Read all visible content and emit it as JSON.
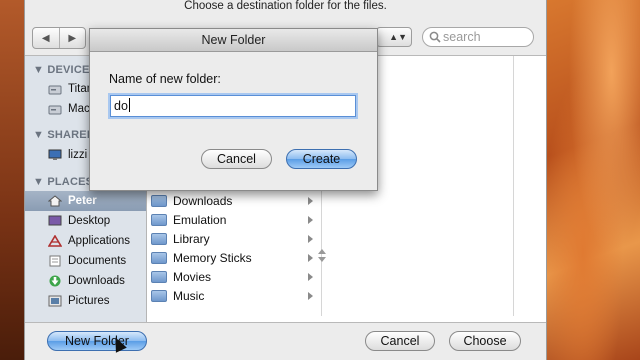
{
  "colors": {
    "accent_blue": "#5a9de6",
    "sidebar_bg": "#dde3ea",
    "selection": "#8a9cb3"
  },
  "sheet": {
    "title": "Choose a destination folder for the files.",
    "search_placeholder": "search"
  },
  "sidebar": {
    "devices_heading": "DEVICES",
    "devices": [
      {
        "label": "Titan",
        "icon": "hard-drive-icon"
      },
      {
        "label": "Maci",
        "icon": "hard-drive-icon"
      }
    ],
    "shared_heading": "SHARED",
    "shared": [
      {
        "label": "lizzi",
        "icon": "network-computer-icon"
      }
    ],
    "places_heading": "PLACES",
    "places": [
      {
        "label": "Peter",
        "icon": "home-icon",
        "selected": true
      },
      {
        "label": "Desktop",
        "icon": "desktop-icon"
      },
      {
        "label": "Applications",
        "icon": "applications-icon"
      },
      {
        "label": "Documents",
        "icon": "documents-icon"
      },
      {
        "label": "Downloads",
        "icon": "downloads-icon"
      },
      {
        "label": "Pictures",
        "icon": "pictures-icon"
      }
    ]
  },
  "browser": {
    "items": [
      {
        "label": "Downloads",
        "icon": "folder-icon"
      },
      {
        "label": "Emulation",
        "icon": "folder-icon"
      },
      {
        "label": "Library",
        "icon": "folder-icon"
      },
      {
        "label": "Memory Sticks",
        "icon": "folder-icon"
      },
      {
        "label": "Movies",
        "icon": "folder-icon"
      },
      {
        "label": "Music",
        "icon": "folder-icon"
      }
    ]
  },
  "footer": {
    "new_folder_label": "New Folder",
    "cancel_label": "Cancel",
    "choose_label": "Choose"
  },
  "dialog": {
    "title": "New Folder",
    "prompt": "Name of new folder:",
    "input_value": "do",
    "cancel_label": "Cancel",
    "create_label": "Create"
  }
}
